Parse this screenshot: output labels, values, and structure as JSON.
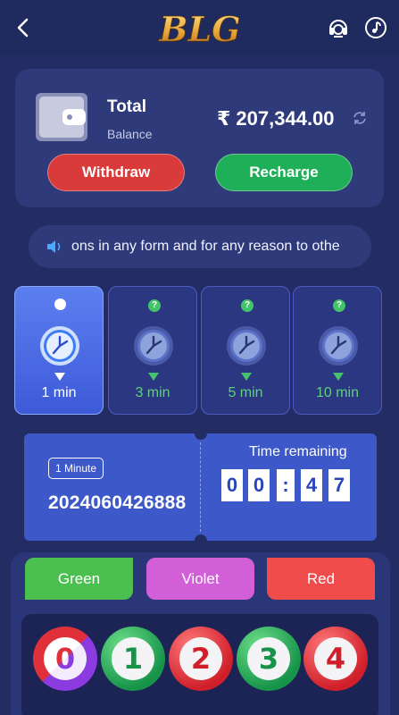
{
  "header": {
    "logo_text": "BLG",
    "back_icon": "chevron-left-icon",
    "support_icon": "headset-icon",
    "music_icon": "music-note-icon"
  },
  "wallet": {
    "total_label": "Total",
    "balance_label": "Balance",
    "amount": "₹ 207,344.00",
    "withdraw_label": "Withdraw",
    "recharge_label": "Recharge"
  },
  "notice": {
    "text": "ons in any form and for any reason to othe"
  },
  "game_tabs": [
    {
      "label": "1 min",
      "active": true
    },
    {
      "label": "3 min",
      "active": false
    },
    {
      "label": "5 min",
      "active": false
    },
    {
      "label": "10 min",
      "active": false
    }
  ],
  "timer": {
    "period_badge": "1 Minute",
    "period_number": "2024060426888",
    "time_label": "Time remaining",
    "digits": [
      "0",
      "0",
      ":",
      "4",
      "7"
    ]
  },
  "bet_colors": {
    "green": "Green",
    "violet": "Violet",
    "red": "Red"
  },
  "balls": [
    "0",
    "1",
    "2",
    "3",
    "4"
  ],
  "colors": {
    "background": "#232d63",
    "green": "#4bbf4f",
    "violet": "#d35fd8",
    "red": "#f04c4c",
    "accent_blue": "#3d58c8"
  }
}
